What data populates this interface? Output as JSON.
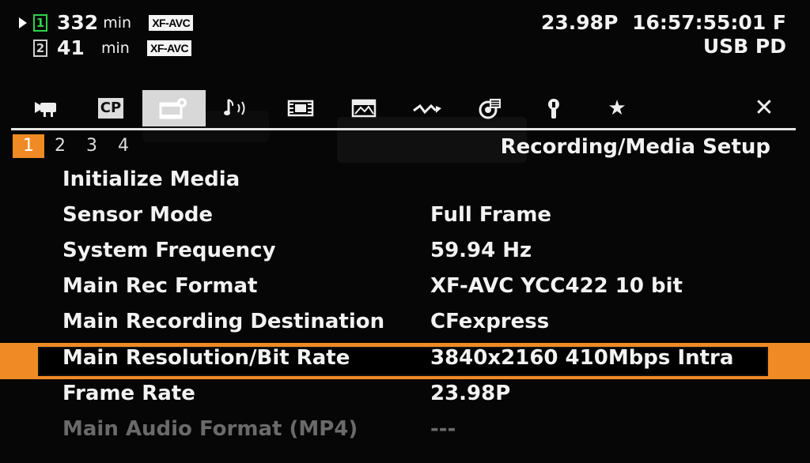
{
  "status": {
    "media": [
      {
        "slot": "1",
        "minutes": "332",
        "unit": "min",
        "format": "XF-AVC",
        "active": true
      },
      {
        "slot": "2",
        "minutes": "41",
        "unit": "min",
        "format": "XF-AVC",
        "active": false
      }
    ],
    "frame_rate": "23.98P",
    "timecode": "16:57:55:01 F",
    "power": "USB PD"
  },
  "tabs": [
    {
      "name": "camera",
      "icon": "camera-icon"
    },
    {
      "name": "cp",
      "label": "CP",
      "icon": "custom-picture-icon"
    },
    {
      "name": "recording-media",
      "icon": "recording-media-setup-icon",
      "active": true
    },
    {
      "name": "audio",
      "icon": "audio-icon"
    },
    {
      "name": "video",
      "icon": "film-icon"
    },
    {
      "name": "assist",
      "icon": "assistance-functions-icon"
    },
    {
      "name": "network",
      "icon": "network-icon"
    },
    {
      "name": "system",
      "icon": "system-setup-icon"
    },
    {
      "name": "maintenance",
      "icon": "wrench-icon"
    },
    {
      "name": "my-menu",
      "icon": "star-icon"
    },
    {
      "name": "close",
      "icon": "close-icon"
    }
  ],
  "pages": [
    "1",
    "2",
    "3",
    "4"
  ],
  "active_page": "1",
  "page_title": "Recording/Media Setup",
  "menu": [
    {
      "label": "Initialize Media",
      "value": ""
    },
    {
      "label": "Sensor Mode",
      "value": "Full Frame"
    },
    {
      "label": "System Frequency",
      "value": "59.94 Hz"
    },
    {
      "label": "Main Rec Format",
      "value": "XF-AVC YCC422 10 bit"
    },
    {
      "label": "Main Recording Destination",
      "value": "CFexpress"
    },
    {
      "label": "Main Resolution/Bit Rate",
      "value": "3840x2160 410Mbps Intra",
      "selected": true
    },
    {
      "label": "Frame Rate",
      "value": "23.98P"
    },
    {
      "label": "Main Audio Format (MP4)",
      "value": "---",
      "disabled": true
    }
  ],
  "colors": {
    "accent": "#f08a24",
    "active_slot": "#2fd34a",
    "background": "#060606",
    "disabled_text": "#6a6a6a"
  }
}
